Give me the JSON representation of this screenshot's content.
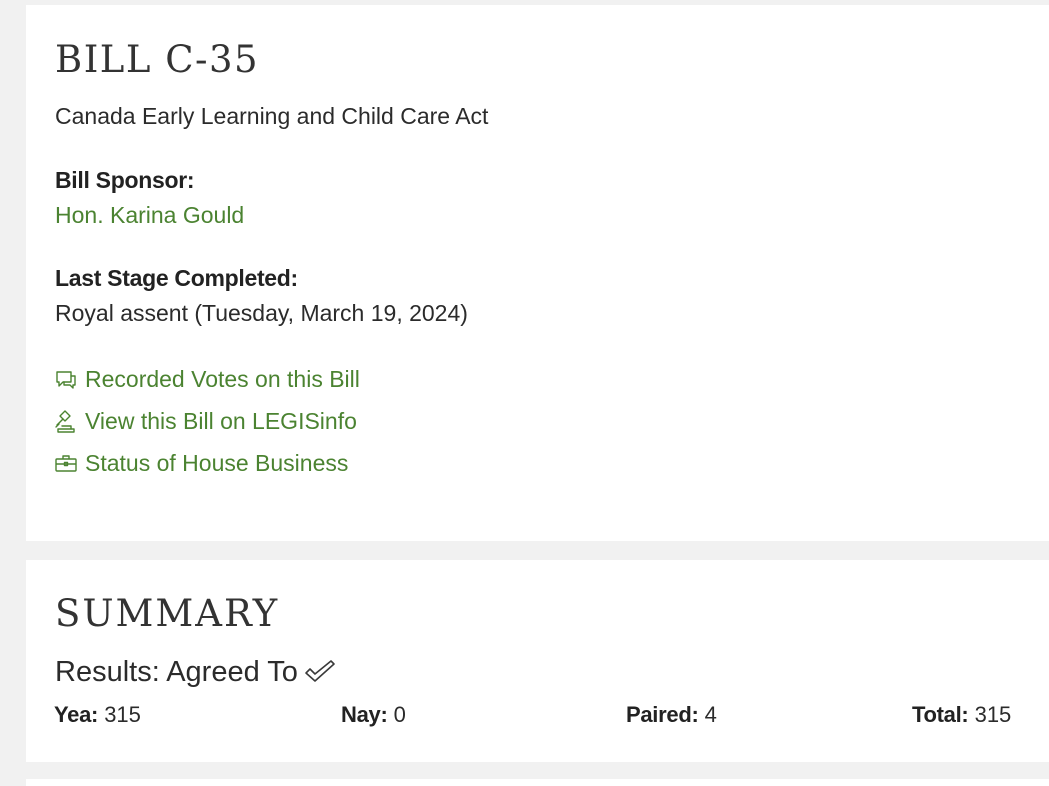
{
  "bill": {
    "title": "BILL C-35",
    "subtitle": "Canada Early Learning and Child Care Act",
    "sponsor_label": "Bill Sponsor:",
    "sponsor_name": "Hon. Karina Gould",
    "stage_label": "Last Stage Completed:",
    "stage_value": "Royal assent (Tuesday, March 19, 2024)",
    "links": [
      {
        "label": "Recorded Votes on this Bill",
        "icon": "chat-icon"
      },
      {
        "label": "View this Bill on LEGISinfo",
        "icon": "gavel-icon"
      },
      {
        "label": "Status of House Business",
        "icon": "briefcase-icon"
      }
    ]
  },
  "summary": {
    "title": "SUMMARY",
    "results_text": "Results: Agreed To",
    "results_icon": "checkmark-icon",
    "yea_label": "Yea:",
    "yea_value": "315",
    "nay_label": "Nay:",
    "nay_value": "0",
    "paired_label": "Paired:",
    "paired_value": "4",
    "total_label": "Total:",
    "total_value": "315"
  },
  "colors": {
    "link_green": "#4b8331",
    "page_background": "#f1f1f1",
    "card_background": "#ffffff"
  }
}
